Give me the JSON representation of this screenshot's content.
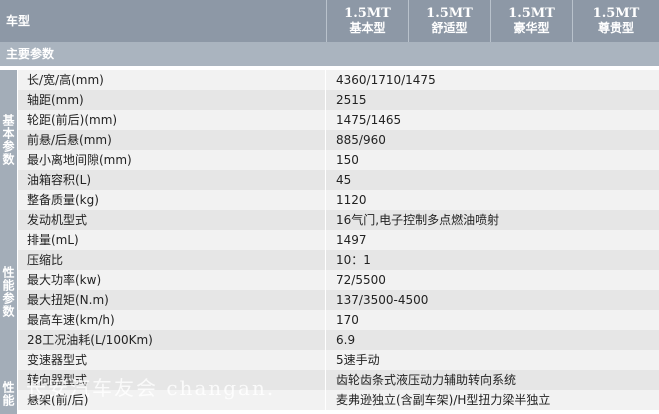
{
  "header": {
    "title": "车型",
    "models": [
      {
        "l1": "1.5MT",
        "l2": "基本型"
      },
      {
        "l1": "1.5MT",
        "l2": "舒适型"
      },
      {
        "l1": "1.5MT",
        "l2": "豪华型"
      },
      {
        "l1": "1.5MT",
        "l2": "尊贵型"
      }
    ]
  },
  "section": "主要参数",
  "groups": [
    {
      "label": "基本参数"
    },
    {
      "label": "性能参数"
    },
    {
      "label": "性能"
    }
  ],
  "rows": [
    {
      "label": "长/宽/高(mm)",
      "value": "4360/1710/1475"
    },
    {
      "label": "轴距(mm)",
      "value": "2515"
    },
    {
      "label": "轮距(前后)(mm)",
      "value": "1475/1465"
    },
    {
      "label": "前悬/后悬(mm)",
      "value": "885/960"
    },
    {
      "label": "最小离地间隙(mm)",
      "value": "150"
    },
    {
      "label": "油箱容积(L)",
      "value": "45"
    },
    {
      "label": "整备质量(kg)",
      "value": "1120"
    },
    {
      "label": "发动机型式",
      "value": "16气门,电子控制多点燃油喷射"
    },
    {
      "label": "排量(mL)",
      "value": "1497"
    },
    {
      "label": "压缩比",
      "value": "10：1"
    },
    {
      "label": "最大功率(kw)",
      "value": "72/5500"
    },
    {
      "label": "最大扭矩(N.m)",
      "value": "137/3500-4500"
    },
    {
      "label": "最高车速(km/h)",
      "value": "170"
    },
    {
      "label": "28工况油耗(L/100Km)",
      "value": "6.9"
    },
    {
      "label": "变速器型式",
      "value": "5速手动"
    },
    {
      "label": "转向器型式",
      "value": "齿轮齿条式液压动力辅助转向系统"
    },
    {
      "label": "悬架(前/后)",
      "value": "麦弗逊独立(含副车架)/H型扭力梁半独立"
    }
  ],
  "watermark": "长安汽车友会 changan."
}
